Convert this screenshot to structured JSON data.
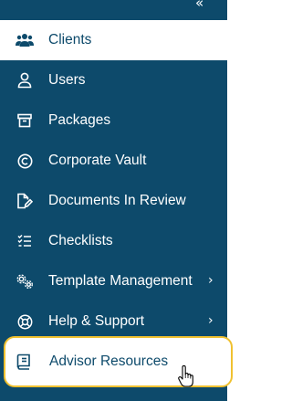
{
  "sidebar": {
    "collapse_glyph": "«",
    "items": [
      {
        "label": "Clients",
        "icon": "users-group-icon",
        "active": true
      },
      {
        "label": "Users",
        "icon": "user-icon"
      },
      {
        "label": "Packages",
        "icon": "archive-box-icon"
      },
      {
        "label": "Corporate Vault",
        "icon": "copyright-icon"
      },
      {
        "label": "Documents In Review",
        "icon": "document-edit-icon"
      },
      {
        "label": "Checklists",
        "icon": "checklist-icon"
      },
      {
        "label": "Template Management",
        "icon": "gears-icon",
        "chevron": "›"
      },
      {
        "label": "Help & Support",
        "icon": "lifebuoy-icon",
        "chevron": "›"
      }
    ],
    "highlighted": {
      "label": "Advisor Resources",
      "icon": "book-icon"
    }
  },
  "colors": {
    "sidebar": "#0d4a6b",
    "highlight_ring": "#f0c130"
  }
}
